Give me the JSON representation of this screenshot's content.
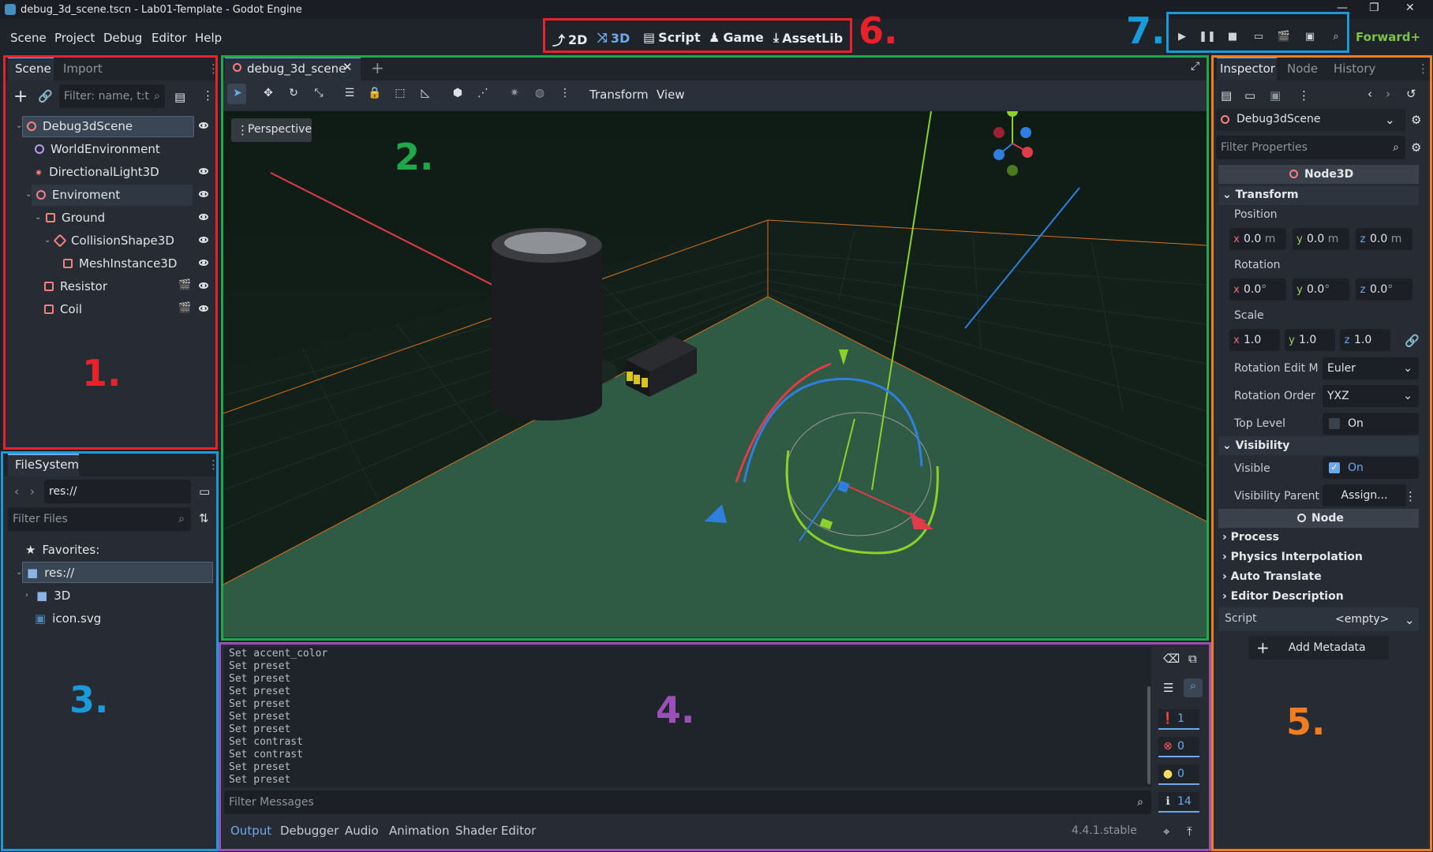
{
  "window": {
    "title": "debug_3d_scene.tscn - Lab01-Template - Godot Engine"
  },
  "menu": [
    "Scene",
    "Project",
    "Debug",
    "Editor",
    "Help"
  ],
  "main_screens": [
    {
      "label": "2D"
    },
    {
      "label": "3D"
    },
    {
      "label": "Script"
    },
    {
      "label": "Game"
    },
    {
      "label": "AssetLib"
    }
  ],
  "renderer": "Forward+",
  "scene_dock": {
    "tabs": [
      "Scene",
      "Import"
    ],
    "filter_placeholder": "Filter: name, t:t",
    "tree": [
      {
        "label": "Debug3dScene"
      },
      {
        "label": "WorldEnvironment"
      },
      {
        "label": "DirectionalLight3D"
      },
      {
        "label": "Enviroment"
      },
      {
        "label": "Ground"
      },
      {
        "label": "CollisionShape3D"
      },
      {
        "label": "MeshInstance3D"
      },
      {
        "label": "Resistor"
      },
      {
        "label": "Coil"
      }
    ]
  },
  "filesystem": {
    "tab": "FileSystem",
    "path": "res://",
    "filter_placeholder": "Filter Files",
    "items": [
      {
        "label": "Favorites:"
      },
      {
        "label": "res://"
      },
      {
        "label": "3D"
      },
      {
        "label": "icon.svg"
      }
    ]
  },
  "viewport": {
    "scene_tab": "debug_3d_scene",
    "menus": [
      "Transform",
      "View"
    ],
    "perspective": "Perspective"
  },
  "output": {
    "lines": [
      "Set accent_color",
      "Set preset",
      "Set preset",
      "Set preset",
      "Set preset",
      "Set preset",
      "Set preset",
      "Set contrast",
      "Set contrast",
      "Set preset",
      "Set preset"
    ],
    "filter_placeholder": "Filter Messages",
    "counts": {
      "messages": "1",
      "errors": "0",
      "warnings": "0",
      "info": "14"
    },
    "bottom_tabs": [
      "Output",
      "Debugger",
      "Audio",
      "Animation",
      "Shader Editor"
    ],
    "version": "4.4.1.stable"
  },
  "inspector": {
    "tabs": [
      "Inspector",
      "Node",
      "History"
    ],
    "object": "Debug3dScene",
    "filter_placeholder": "Filter Properties",
    "class_header": "Node3D",
    "transform": "Transform",
    "position_label": "Position",
    "position": {
      "x": "0.0",
      "y": "0.0",
      "z": "0.0",
      "unit": "m"
    },
    "rotation_label": "Rotation",
    "rotation": {
      "x": "0.0",
      "y": "0.0",
      "z": "0.0",
      "unit": "°"
    },
    "scale_label": "Scale",
    "scale": {
      "x": "1.0",
      "y": "1.0",
      "z": "1.0"
    },
    "rotation_edit_label": "Rotation Edit M",
    "rotation_edit_value": "Euler",
    "rotation_order_label": "Rotation Order",
    "rotation_order_value": "YXZ",
    "top_level_label": "Top Level",
    "top_level_value": "On",
    "visibility": "Visibility",
    "visible_label": "Visible",
    "visible_value": "On",
    "visibility_parent_label": "Visibility Parent",
    "visibility_parent_value": "Assign...",
    "node_header": "Node",
    "sections": [
      "Process",
      "Physics Interpolation",
      "Auto Translate",
      "Editor Description"
    ],
    "script_label": "Script",
    "script_value": "<empty>",
    "add_metadata": "Add Metadata"
  },
  "annotations": [
    "1.",
    "2.",
    "3.",
    "4.",
    "5.",
    "6.",
    "7."
  ],
  "colors": {
    "accent": "#6fa8ea",
    "red": "#e8212b",
    "green": "#1fa84a",
    "blue": "#1a9ad9",
    "purple": "#9b4fb8",
    "orange": "#ef7d22"
  }
}
